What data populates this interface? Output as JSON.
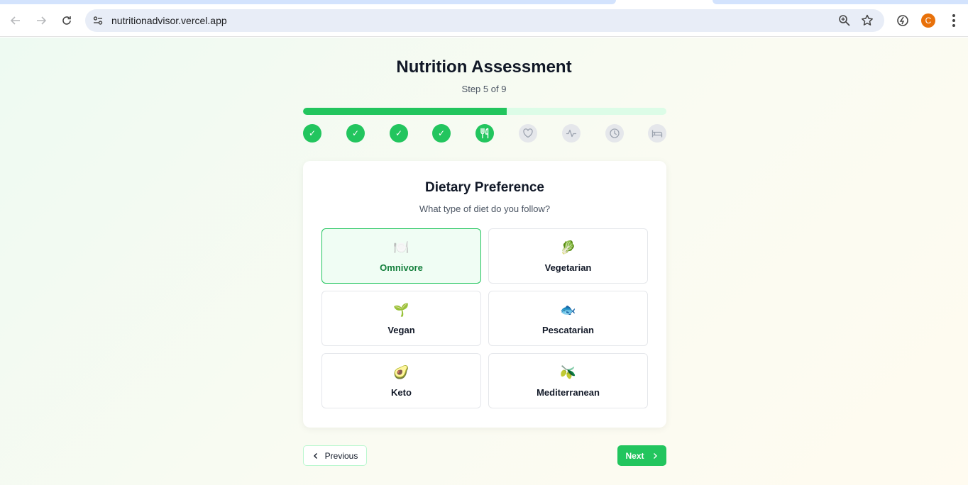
{
  "browser": {
    "url": "nutritionadvisor.vercel.app",
    "profile_initial": "C"
  },
  "assessment": {
    "title": "Nutrition Assessment",
    "step_text": "Step 5 of 9",
    "progress_fraction": 0.56,
    "steps": [
      {
        "state": "done",
        "icon": "check-icon"
      },
      {
        "state": "done",
        "icon": "check-icon"
      },
      {
        "state": "done",
        "icon": "check-icon"
      },
      {
        "state": "done",
        "icon": "check-icon"
      },
      {
        "state": "current",
        "icon": "utensils-icon"
      },
      {
        "state": "todo",
        "icon": "heart-icon"
      },
      {
        "state": "todo",
        "icon": "activity-icon"
      },
      {
        "state": "todo",
        "icon": "clock-icon"
      },
      {
        "state": "todo",
        "icon": "bed-icon"
      }
    ]
  },
  "question": {
    "title": "Dietary Preference",
    "subtitle": "What type of diet do you follow?",
    "options": [
      {
        "label": "Omnivore",
        "emoji": "🍽️",
        "selected": true
      },
      {
        "label": "Vegetarian",
        "emoji": "🥬",
        "selected": false
      },
      {
        "label": "Vegan",
        "emoji": "🌱",
        "selected": false
      },
      {
        "label": "Pescatarian",
        "emoji": "🐟",
        "selected": false
      },
      {
        "label": "Keto",
        "emoji": "🥑",
        "selected": false
      },
      {
        "label": "Mediterranean",
        "emoji": "🫒",
        "selected": false
      }
    ]
  },
  "nav": {
    "previous_label": "Previous",
    "next_label": "Next"
  },
  "colors": {
    "accent": "#22c55e",
    "accent_light": "#dcfce7",
    "selected_bg": "#f0fdf4"
  }
}
